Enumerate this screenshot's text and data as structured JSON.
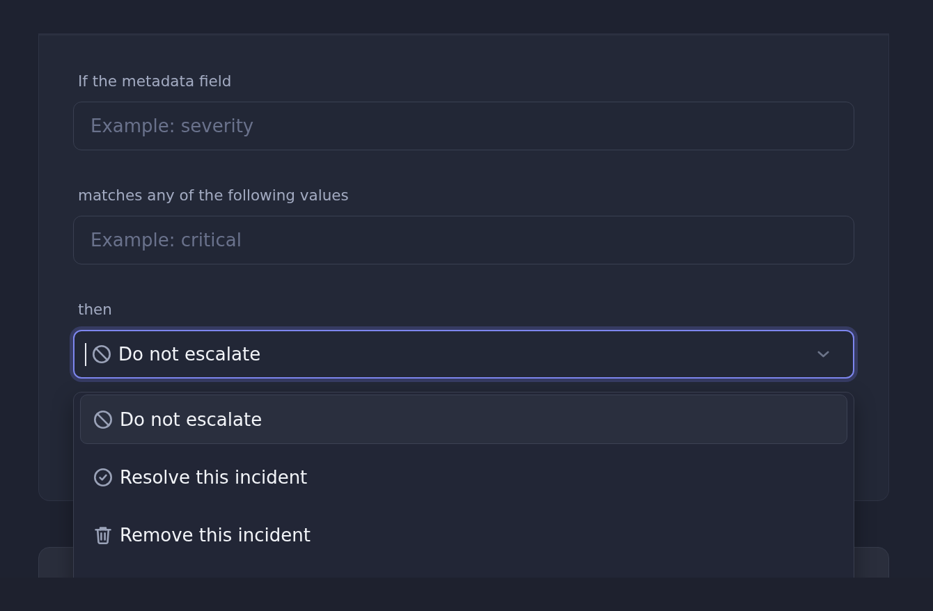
{
  "fields": [
    {
      "label": "If the metadata field",
      "placeholder": "Example: severity"
    },
    {
      "label": "matches any of the following values",
      "placeholder": "Example: critical"
    }
  ],
  "action": {
    "label": "then",
    "value": "Do not escalate",
    "kind": "ignore",
    "focused": true,
    "expanded": true,
    "options": [
      {
        "label": "Do not escalate",
        "kind": "ignore",
        "selected": true
      },
      {
        "label": "Resolve this incident",
        "kind": "resolve",
        "selected": false
      },
      {
        "label": "Remove this incident",
        "kind": "remove",
        "selected": false
      }
    ]
  }
}
